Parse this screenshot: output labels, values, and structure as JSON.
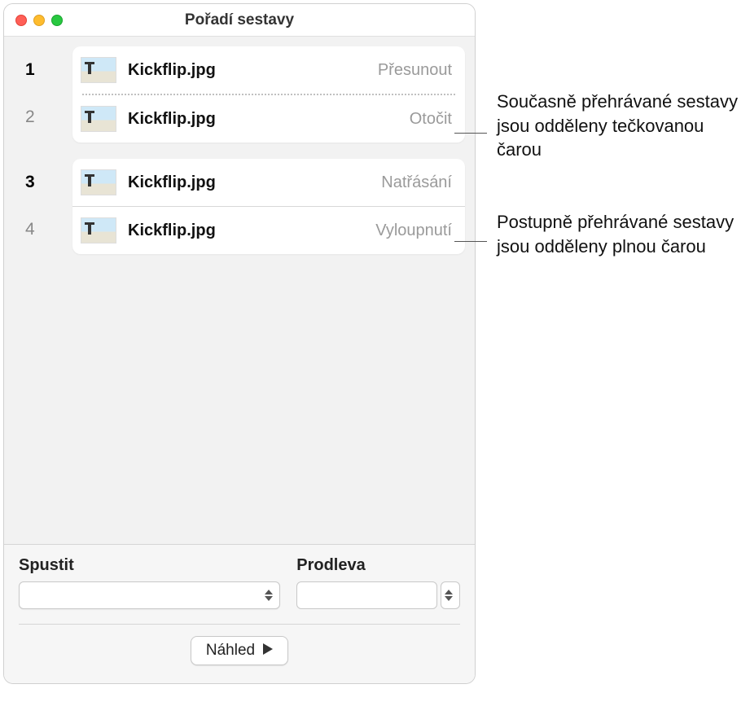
{
  "window": {
    "title": "Pořadí sestavy"
  },
  "groups": [
    {
      "separator": "dotted",
      "rows": [
        {
          "index": "1",
          "bold": true,
          "filename": "Kickflip.jpg",
          "action": "Přesunout"
        },
        {
          "index": "2",
          "bold": false,
          "filename": "Kickflip.jpg",
          "action": "Otočit"
        }
      ]
    },
    {
      "separator": "solid",
      "rows": [
        {
          "index": "3",
          "bold": true,
          "filename": "Kickflip.jpg",
          "action": "Natřásání"
        },
        {
          "index": "4",
          "bold": false,
          "filename": "Kickflip.jpg",
          "action": "Vyloupnutí"
        }
      ]
    }
  ],
  "footer": {
    "run_label": "Spustit",
    "delay_label": "Prodleva",
    "preview_label": "Náhled"
  },
  "annotations": {
    "c1": "Současně přehrávané sestavy jsou odděleny tečkovanou čarou",
    "c2": "Postupně přehrávané sestavy jsou odděleny plnou čarou"
  }
}
